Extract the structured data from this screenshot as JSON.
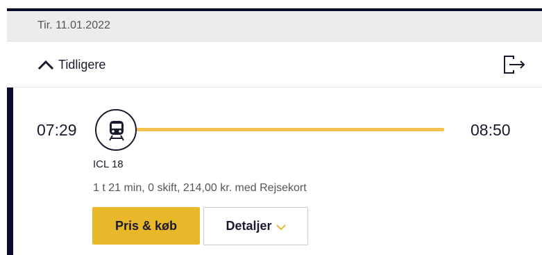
{
  "date_row": {
    "date": "Tir. 11.01.2022"
  },
  "earlier": {
    "label": "Tidligere",
    "icon": "chevron-up-icon"
  },
  "exit": {
    "icon": "exit-icon"
  },
  "trip": {
    "departure": "07:29",
    "arrival": "08:50",
    "train_icon": "train-icon",
    "train_name": "ICL 18",
    "summary": "1 t 21 min, 0 skift, 214,00 kr. med Rejsekort",
    "buy_label": "Pris & køb",
    "details_label": "Detaljer",
    "details_icon": "chevron-down-icon"
  },
  "colors": {
    "accent_dark": "#0b0b2c",
    "route_line": "#f7c14f",
    "buy_button": "#e8b82a",
    "date_bg": "#ececec"
  }
}
